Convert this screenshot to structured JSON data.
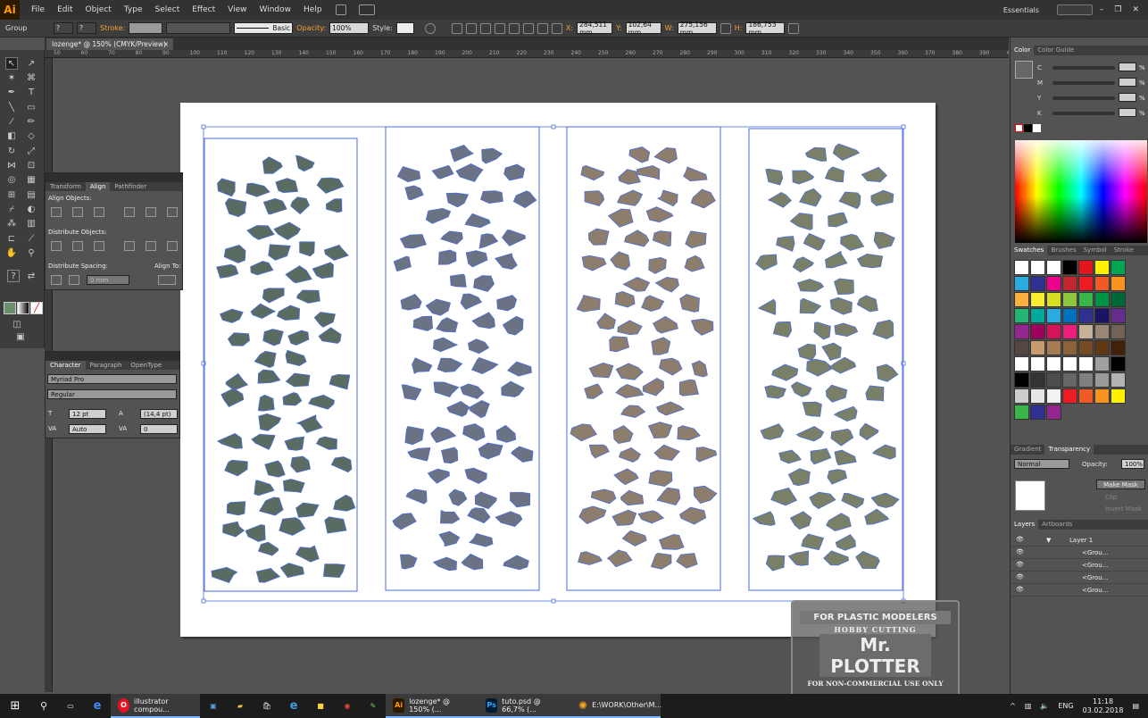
{
  "app": {
    "logo": "Ai",
    "workspace": "Essentials"
  },
  "menu": [
    "File",
    "Edit",
    "Object",
    "Type",
    "Select",
    "Effect",
    "View",
    "Window",
    "Help"
  ],
  "control_bar": {
    "selection": "Group",
    "stroke_label": "Stroke:",
    "brush": "Basic",
    "opacity_label": "Opacity:",
    "opacity": "100%",
    "style_label": "Style:",
    "x_label": "X:",
    "x": "284,511 mm",
    "y_label": "Y:",
    "y": "102,64 mm",
    "w_label": "W:",
    "w": "275,156 mm",
    "h_label": "H:",
    "h": "186,753 mm"
  },
  "document_tab": {
    "title": "lozenge* @ 150% (CMYK/Preview)"
  },
  "ruler_numbers": [
    "50",
    "60",
    "70",
    "80",
    "90",
    "100",
    "110",
    "120",
    "130",
    "140",
    "150",
    "160",
    "170",
    "180",
    "190",
    "200",
    "210",
    "220",
    "230",
    "240",
    "250",
    "260",
    "270",
    "280",
    "290",
    "300",
    "310",
    "320",
    "330",
    "340",
    "350",
    "360",
    "370",
    "380",
    "390",
    "400"
  ],
  "align_panel": {
    "tabs": [
      "Transform",
      "Align",
      "Pathfinder"
    ],
    "align_objects": "Align Objects:",
    "distribute_objects": "Distribute Objects:",
    "distribute_spacing": "Distribute Spacing:",
    "align_to": "Align To:",
    "spacing_value": "0 mm"
  },
  "character_panel": {
    "tabs": [
      "Character",
      "Paragraph",
      "OpenType"
    ],
    "font": "Myriad Pro",
    "style": "Regular",
    "size": "12 pt",
    "leading": "(14,4 pt)",
    "kerning": "Auto",
    "tracking": "0"
  },
  "color_panel": {
    "tabs": [
      "Color",
      "Color Guide"
    ],
    "channels": [
      "C",
      "M",
      "Y",
      "K"
    ],
    "unit": "%"
  },
  "swatches_panel": {
    "tabs": [
      "Swatches",
      "Brushes",
      "Symbol",
      "Stroke"
    ],
    "colors": [
      "#ffffff",
      "#ffffff",
      "#ffffff",
      "#000000",
      "#e3161f",
      "#fff200",
      "#00a651",
      "#29abe2",
      "#2e3192",
      "#ec008c",
      "#c1272d",
      "#ed1c24",
      "#f15a24",
      "#f7931e",
      "#fbb040",
      "#f9ed32",
      "#d7df23",
      "#8dc63f",
      "#39b54a",
      "#009245",
      "#006837",
      "#22b573",
      "#00a99d",
      "#29abe2",
      "#0071bc",
      "#2e3192",
      "#1b1464",
      "#662d91",
      "#93278f",
      "#9e005d",
      "#d4145a",
      "#ed1e79",
      "#c7b299",
      "#998675",
      "#736357",
      "#534741",
      "#c69c6d",
      "#a67c52",
      "#8c6239",
      "#754c24",
      "#603813",
      "#42210b",
      "#ffffff",
      "#ffffff",
      "#ffffff",
      "#ffffff",
      "#ffffff",
      "#a0a0a0",
      "#000000",
      "#000000",
      "#333333",
      "#4d4d4d",
      "#666666",
      "#808080",
      "#999999",
      "#b3b3b3",
      "#cccccc",
      "#e6e6e6",
      "#f2f2f2",
      "#ed1c24",
      "#f15a24",
      "#f7931e",
      "#fff200",
      "#39b54a",
      "#2e3192",
      "#93278f"
    ]
  },
  "transparency_panel": {
    "tabs": [
      "Gradient",
      "Transparency"
    ],
    "blend_mode": "Normal",
    "opacity_label": "Opacity:",
    "opacity": "100%",
    "make_mask": "Make Mask",
    "clip": "Clip",
    "invert_mask": "Invert Mask"
  },
  "layers_panel": {
    "tabs": [
      "Layers",
      "Artboards"
    ],
    "layer": "Layer 1",
    "items": [
      "<Grou...",
      "<Grou...",
      "<Grou...",
      "<Grou..."
    ]
  },
  "artwork": {
    "colors": [
      "#5a6b62",
      "#6b7283",
      "#8c7d6c",
      "#7a8067"
    ],
    "selection_color": "#4a6ee0"
  },
  "watermark": {
    "line1": "FOR PLASTIC MODELERS",
    "line2": "HOBBY CUTTING",
    "line3": "Mr. PLOTTER",
    "line4": "FOR NON-COMMERCIAL USE ONLY"
  },
  "taskbar": {
    "items": [
      "illustrator compou...",
      "lozenge* @ 150% (...",
      "tuto.psd @ 66,7% (...",
      "E:\\WORK\\Other\\M..."
    ],
    "lang": "ENG",
    "time": "11:18",
    "date": "03.02.2018"
  }
}
